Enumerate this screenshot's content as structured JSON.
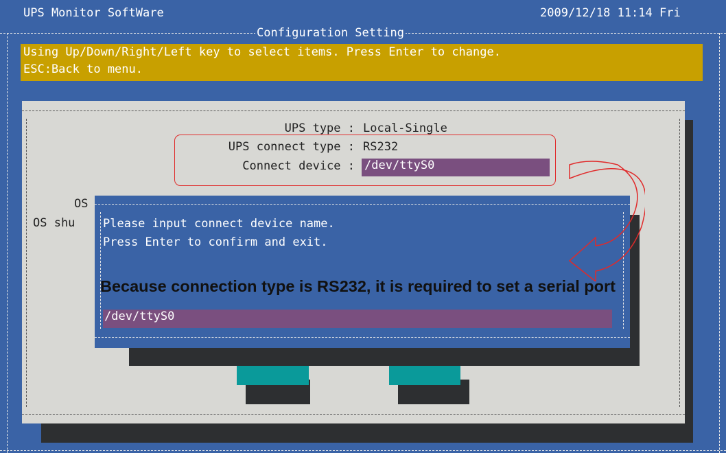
{
  "header": {
    "app_title": "UPS Monitor SoftWare",
    "datetime": "2009/12/18 11:14 Fri"
  },
  "screen": {
    "section_title": "Configuration Setting",
    "help_line_1": "Using Up/Down/Right/Left key to select items. Press Enter to change.",
    "help_line_2": "ESC:Back to menu."
  },
  "config": {
    "rows": [
      {
        "label": "UPS type :",
        "value": "Local-Single"
      },
      {
        "label": "UPS connect type :",
        "value": "RS232"
      },
      {
        "label": "Connect device :",
        "value": "/dev/ttyS0"
      }
    ],
    "partial_label_1": "OS",
    "partial_label_2": "OS shu"
  },
  "dialog": {
    "line_1": "Please input connect device name.",
    "line_2": "Press Enter to confirm and exit.",
    "input_value": "/dev/ttyS0"
  },
  "annotation": {
    "text": "Because connection type is RS232, it is required to set a serial port"
  },
  "colors": {
    "background": "#3a63a6",
    "banner": "#c8a000",
    "panel": "#d8d8d4",
    "input": "#7a4f7f",
    "button": "#0a9a9a",
    "highlight": "#e02a2a"
  }
}
